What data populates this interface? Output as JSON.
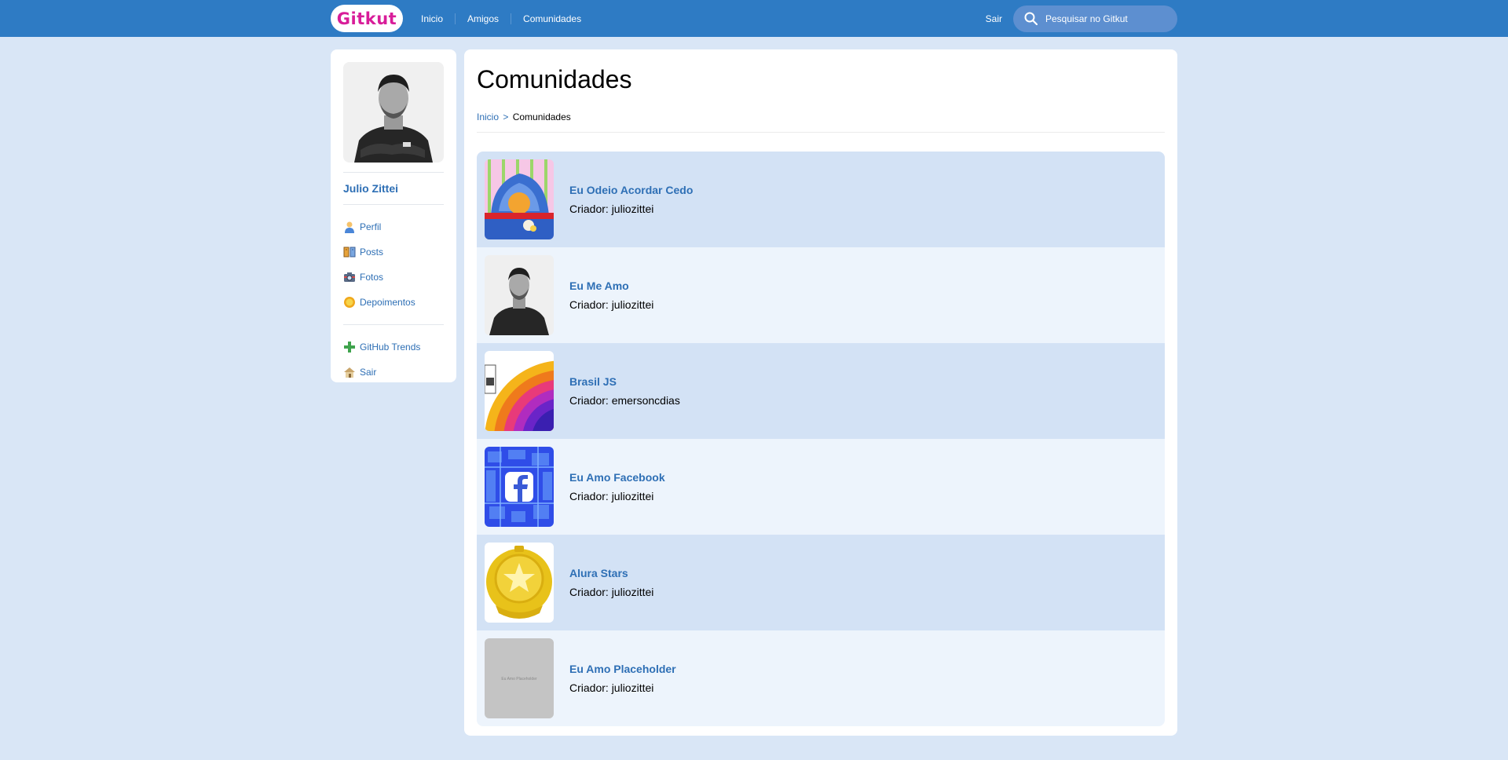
{
  "topbar": {
    "logo": "Gitkut",
    "nav": [
      "Inicio",
      "Amigos",
      "Comunidades"
    ],
    "logout": "Sair",
    "search_placeholder": "Pesquisar no Gitkut"
  },
  "sidebar": {
    "user_name": "Julio Zittei",
    "menu": [
      {
        "label": "Perfil",
        "icon": "user-icon"
      },
      {
        "label": "Posts",
        "icon": "book-icon"
      },
      {
        "label": "Fotos",
        "icon": "camera-icon"
      },
      {
        "label": "Depoimentos",
        "icon": "sun-icon"
      }
    ],
    "menu2": [
      {
        "label": "GitHub Trends",
        "icon": "plus-icon"
      },
      {
        "label": "Sair",
        "icon": "home-icon"
      }
    ]
  },
  "main": {
    "title": "Comunidades",
    "breadcrumb": {
      "home": "Inicio",
      "separator": ">",
      "current": "Comunidades"
    },
    "creator_prefix": "Criador:",
    "communities": [
      {
        "name": "Eu Odeio Acordar Cedo",
        "creator": "juliozittei",
        "image": "garfield"
      },
      {
        "name": "Eu Me Amo",
        "creator": "juliozittei",
        "image": "profile-photo"
      },
      {
        "name": "Brasil JS",
        "creator": "emersoncdias",
        "image": "rainbow"
      },
      {
        "name": "Eu Amo Facebook",
        "creator": "juliozittei",
        "image": "facebook-logo"
      },
      {
        "name": "Alura Stars",
        "creator": "juliozittei",
        "image": "alura-stars-badge"
      },
      {
        "name": "Eu Amo Placeholder",
        "creator": "juliozittei",
        "image": "placeholder",
        "placeholder_text": "Eu Amo Placeholder"
      }
    ]
  },
  "colors": {
    "background": "#d9e6f6",
    "topbar": "#2e7bc4",
    "logo_text": "#d81d99",
    "link": "#2e6fb5",
    "row_odd": "#d3e2f5",
    "row_even": "#edf4fc"
  }
}
